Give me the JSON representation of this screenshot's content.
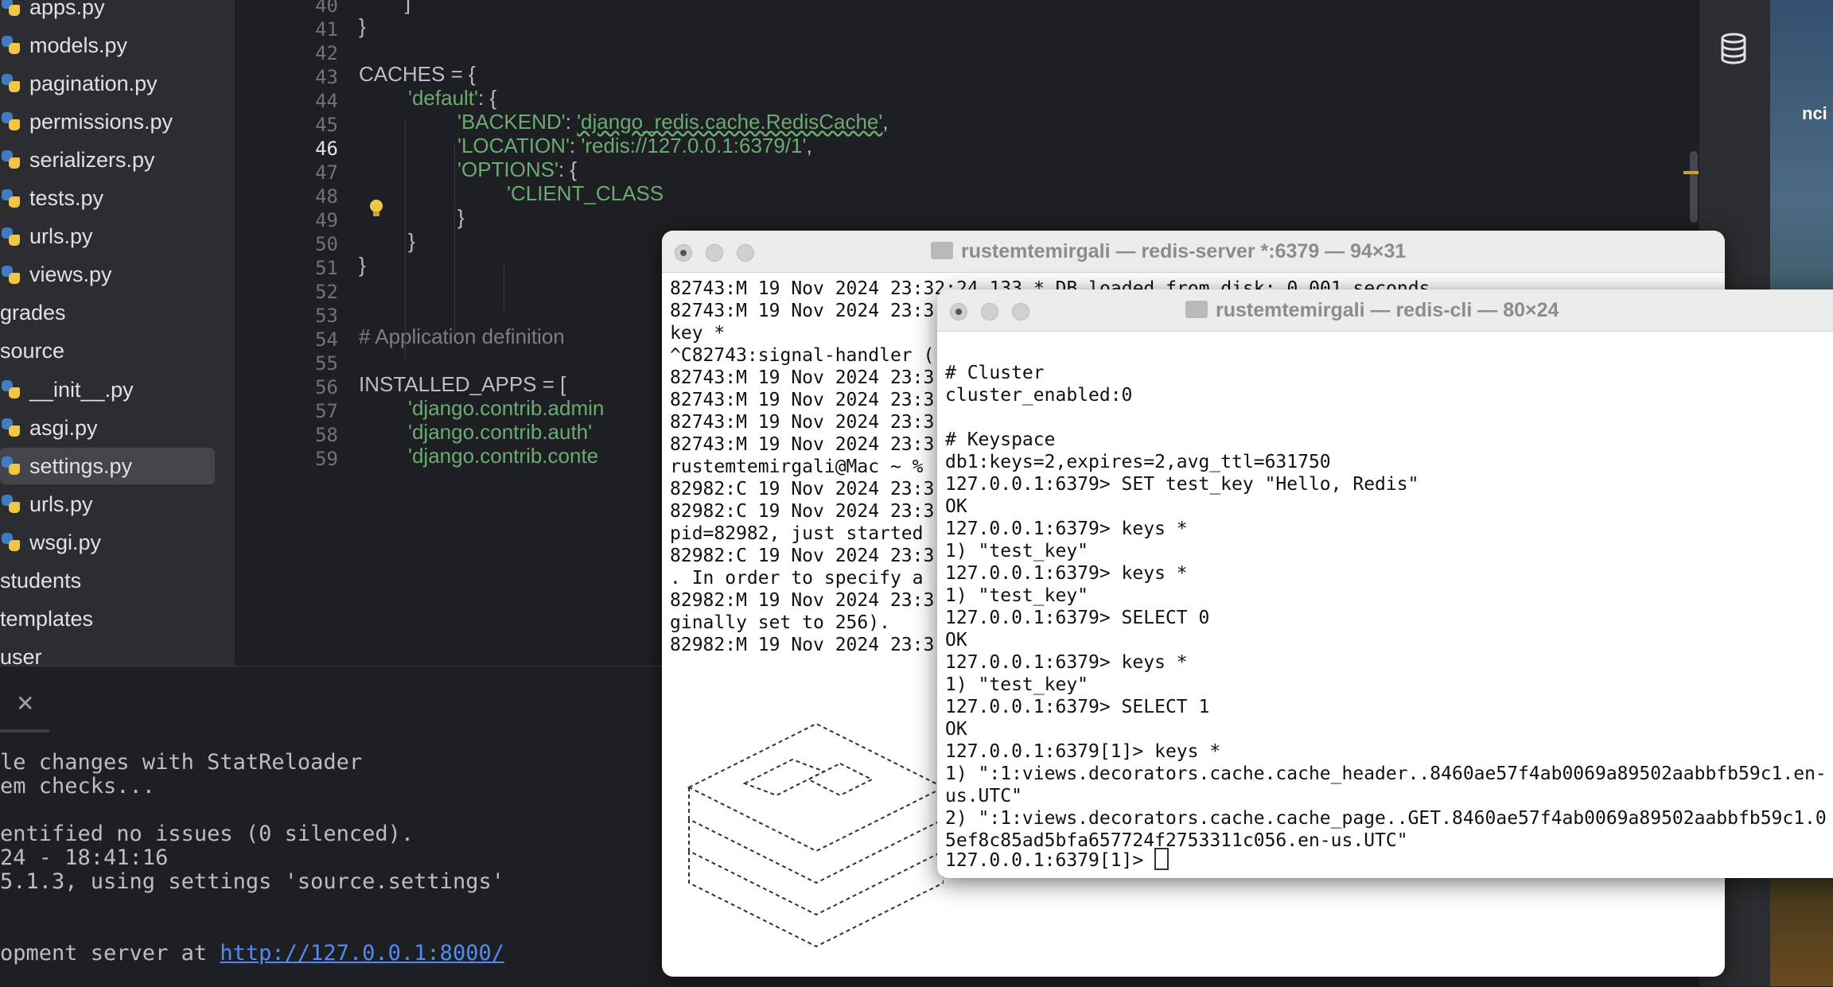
{
  "project_tree": {
    "items": [
      {
        "label": "apps.py",
        "type": "python"
      },
      {
        "label": "models.py",
        "type": "python"
      },
      {
        "label": "pagination.py",
        "type": "python"
      },
      {
        "label": "permissions.py",
        "type": "python"
      },
      {
        "label": "serializers.py",
        "type": "python"
      },
      {
        "label": "tests.py",
        "type": "python"
      },
      {
        "label": "urls.py",
        "type": "python"
      },
      {
        "label": "views.py",
        "type": "python"
      },
      {
        "label": "grades",
        "type": "folder"
      },
      {
        "label": "source",
        "type": "folder"
      },
      {
        "label": "__init__.py",
        "type": "python"
      },
      {
        "label": "asgi.py",
        "type": "python"
      },
      {
        "label": "settings.py",
        "type": "python",
        "selected": true
      },
      {
        "label": "urls.py",
        "type": "python"
      },
      {
        "label": "wsgi.py",
        "type": "python"
      },
      {
        "label": "students",
        "type": "folder"
      },
      {
        "label": "templates",
        "type": "folder"
      },
      {
        "label": "user",
        "type": "folder"
      }
    ]
  },
  "editor": {
    "line_numbers": [
      "40",
      "41",
      "42",
      "43",
      "44",
      "45",
      "46",
      "47",
      "48",
      "49",
      "50",
      "51",
      "52",
      "53",
      "54",
      "55",
      "56",
      "57",
      "58",
      "59"
    ],
    "current_line": "46",
    "lines": {
      "l40": "        ]",
      "l41": "}",
      "l43": "CACHES = {",
      "l44_key": "'default'",
      "l44_rest": ": {",
      "l45_key": "'BACKEND'",
      "l45_sep": ": ",
      "l45_val": "'django_redis.cache.RedisCache'",
      "l45_end": ",",
      "l46_key": "'LOCATION'",
      "l46_sep": ": ",
      "l46_val": "'redis://127.0.0.1:6379/1'",
      "l46_end": ",",
      "l47_key": "'OPTIONS'",
      "l47_rest": ": {",
      "l48_key": "'CLIENT_CLASS",
      "l49": "}",
      "l50": "}",
      "l51": "}",
      "l54": "# Application definition",
      "l56": "INSTALLED_APPS = [",
      "l57": "'django.contrib.admin",
      "l58": "'django.contrib.auth'",
      "l59": "'django.contrib.conte"
    }
  },
  "run_panel": {
    "lines": [
      "le changes with StatReloader",
      "em checks...",
      "",
      "entified no issues (0 silenced).",
      "24 - 18:41:16",
      "5.1.3, using settings 'source.settings'"
    ],
    "server_prefix": "opment server at ",
    "server_link": "http://127.0.0.1:8000/"
  },
  "redis_server_window": {
    "title": "rustemtemirgali — redis-server *:6379 — 94×31",
    "lines": [
      "82743:M 19 Nov 2024 23:32:24.133 * DB loaded from disk: 0.001 seconds",
      "82743:M 19 Nov 2024 23:3",
      "key *",
      "^C82743:signal-handler (",
      "82743:M 19 Nov 2024 23:3",
      "82743:M 19 Nov 2024 23:3",
      "82743:M 19 Nov 2024 23:3",
      "82743:M 19 Nov 2024 23:3",
      "rustemtemirgali@Mac ~ %",
      "82982:C 19 Nov 2024 23:3",
      "82982:C 19 Nov 2024 23:3",
      "pid=82982, just started",
      "82982:C 19 Nov 2024 23:3",
      ". In order to specify a",
      "82982:M 19 Nov 2024 23:3",
      "ginally set to 256).",
      "82982:M 19 Nov 2024 23:3"
    ]
  },
  "redis_cli_window": {
    "title": "rustemtemirgali — redis-cli — 80×24",
    "lines": [
      "",
      "# Cluster",
      "cluster_enabled:0",
      "",
      "# Keyspace",
      "db1:keys=2,expires=2,avg_ttl=631750",
      "127.0.0.1:6379> SET test_key \"Hello, Redis\"",
      "OK",
      "127.0.0.1:6379> keys *",
      "1) \"test_key\"",
      "127.0.0.1:6379> keys *",
      "1) \"test_key\"",
      "127.0.0.1:6379> SELECT 0",
      "OK",
      "127.0.0.1:6379> keys *",
      "1) \"test_key\"",
      "127.0.0.1:6379> SELECT 1",
      "OK",
      "127.0.0.1:6379[1]> keys *",
      "1) \":1:views.decorators.cache.cache_header..8460ae57f4ab0069a89502aabbfb59c1.en-",
      "us.UTC\"",
      "2) \":1:views.decorators.cache.cache_page..GET.8460ae57f4ab0069a89502aabbfb59c1.0",
      "5ef8c85ad5bfa657724f2753311c056.en-us.UTC\""
    ],
    "prompt": "127.0.0.1:6379[1]> "
  },
  "desktop": {
    "label": "nci"
  },
  "icons": {
    "right_strip": "database-icon",
    "editor_gutter": "lightbulb-icon",
    "run_panel": "close-icon"
  },
  "colors": {
    "editor_bg": "#1e1f22",
    "string": "#6aab73",
    "comment": "#7a7e85",
    "link": "#548af7",
    "bulb": "#f1c644"
  }
}
